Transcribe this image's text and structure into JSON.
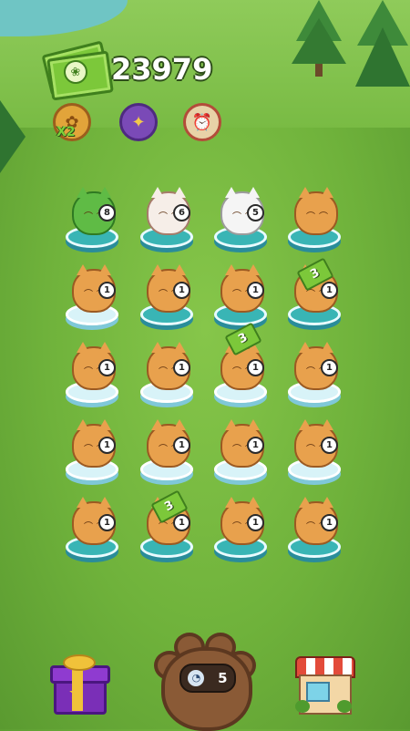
{
  "currency": {
    "amount": "23979",
    "icon": "paw-cash-icon"
  },
  "boosts": [
    {
      "name": "coin-boost",
      "label": "X2",
      "icon": "coin-icon"
    },
    {
      "name": "magic-wand",
      "icon": "wand-icon"
    },
    {
      "name": "alarm-clock",
      "icon": "clock-icon"
    }
  ],
  "grid": {
    "rows": [
      [
        {
          "cat": "cactus",
          "level": "8"
        },
        {
          "cat": "calico",
          "level": "6"
        },
        {
          "cat": "white",
          "level": "5"
        },
        {
          "cat": "orange",
          "level": ""
        }
      ],
      [
        {
          "cat": "orange",
          "level": "1"
        },
        {
          "cat": "orange",
          "level": "1"
        },
        {
          "cat": "orange",
          "level": "1"
        },
        {
          "cat": "orange",
          "level": "1",
          "cash": "3"
        }
      ],
      [
        {
          "cat": "orange",
          "level": "1"
        },
        {
          "cat": "orange",
          "level": "1"
        },
        {
          "cat": "orange",
          "level": "1",
          "cash": "3"
        },
        {
          "cat": "orange",
          "level": "1"
        }
      ],
      [
        {
          "cat": "orange",
          "level": "1"
        },
        {
          "cat": "orange",
          "level": "1"
        },
        {
          "cat": "orange",
          "level": "1"
        },
        {
          "cat": "orange",
          "level": "1"
        }
      ],
      [
        {
          "cat": "orange",
          "level": "1"
        },
        {
          "cat": "orange",
          "level": "1",
          "cash": "3"
        },
        {
          "cat": "orange",
          "level": "1"
        },
        {
          "cat": "orange",
          "level": "1"
        }
      ]
    ]
  },
  "bottom_bar": {
    "gift_icon": "gift-box-icon",
    "paw_counter": "5",
    "paw_counter_icon": "compass-icon",
    "shop_icon": "shop-icon"
  }
}
